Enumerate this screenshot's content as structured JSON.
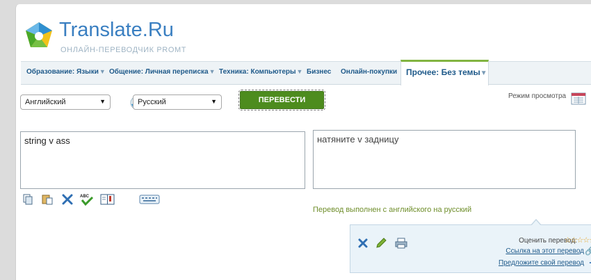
{
  "logo": {
    "title": "Translate.Ru",
    "subtitle": "ОНЛАЙН-ПЕРЕВОДЧИК PROMT"
  },
  "tabs": [
    {
      "label": "Образование: Языки",
      "arrow": "▼"
    },
    {
      "label": "Общение: Личная переписка",
      "arrow": "▼"
    },
    {
      "label": "Техника: Компьютеры",
      "arrow": "▼"
    },
    {
      "label": "Бизнес",
      "arrow": ""
    },
    {
      "label": "Онлайн-покупки",
      "arrow": ""
    }
  ],
  "active_tab": {
    "label": "Прочее: Без темы",
    "arrow": "▼"
  },
  "source_language": "Английский",
  "target_language": "Русский",
  "translate_button": "ПЕРЕВЕСТИ",
  "view_mode_label": "Режим просмотра",
  "source_text": "string v ass",
  "translated_text": "натяните v задницу",
  "status_text": "Перевод выполнен с английского на русский",
  "rating_panel": {
    "rate_label": "Оценить перевод:",
    "stars": "☆☆☆☆☆",
    "link_label": "Ссылка на этот перевод",
    "suggest_label": "Предложите свой перевод"
  },
  "icons": {
    "toolbar": [
      "copy-icon",
      "paste-icon",
      "clear-icon",
      "spellcheck-icon",
      "dictionary-icon",
      "keyboard-icon"
    ],
    "panel": [
      "delete-icon",
      "edit-icon",
      "print-icon",
      "link-icon",
      "plus-icon"
    ]
  },
  "colors": {
    "accent_green": "#4d8c1e",
    "link_blue": "#1f5a8a",
    "status_green": "#6f8e2b",
    "tab_active_border": "#82b441"
  }
}
